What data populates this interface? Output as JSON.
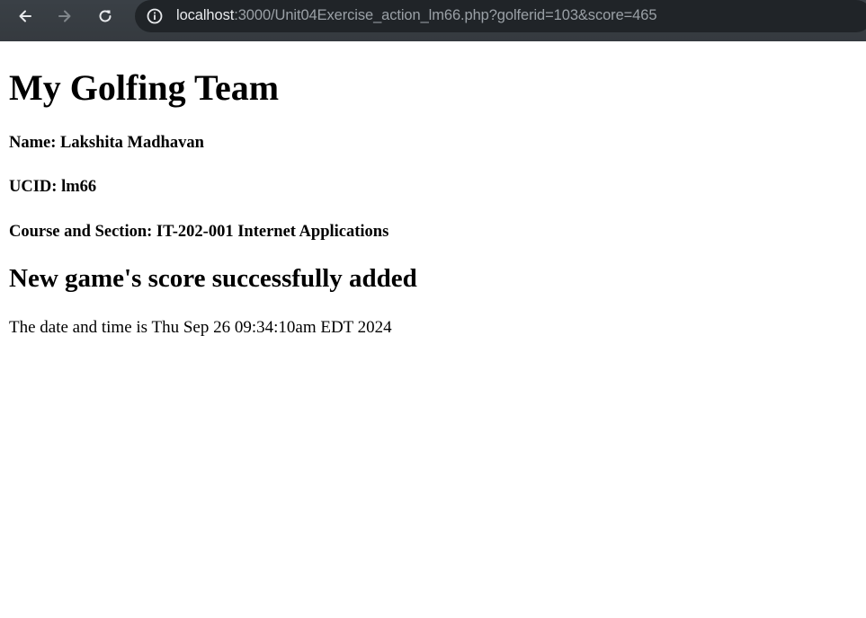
{
  "browser": {
    "url_host": "localhost",
    "url_rest": ":3000/Unit04Exercise_action_lm66.php?golferid=103&score=465",
    "icons": {
      "back": "arrow-left-icon",
      "forward": "arrow-right-icon",
      "reload": "reload-icon",
      "site_info": "info-icon"
    }
  },
  "page": {
    "title": "My Golfing Team",
    "name_line": "Name: Lakshita Madhavan",
    "ucid_line": "UCID: lm66",
    "course_line": "Course and Section: IT-202-001 Internet Applications",
    "status_heading": "New game's score successfully added",
    "datetime_text": "The date and time is Thu Sep 26 09:34:10am EDT 2024"
  }
}
